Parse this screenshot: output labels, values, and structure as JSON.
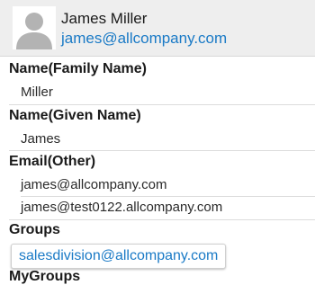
{
  "header": {
    "avatar_icon": "person-silhouette-icon",
    "name": "James Miller",
    "email": "james@allcompany.com"
  },
  "fields": {
    "family_name": {
      "label": "Name(Family Name)",
      "value": "Miller"
    },
    "given_name": {
      "label": "Name(Given Name)",
      "value": "James"
    },
    "email_other": {
      "label": "Email(Other)",
      "values": [
        "james@allcompany.com",
        "james@test0122.allcompany.com"
      ]
    },
    "groups": {
      "label": "Groups",
      "items": [
        "salesdivision@allcompany.com"
      ]
    },
    "my_groups": {
      "label": "MyGroups"
    }
  },
  "colors": {
    "link": "#1a7ac6",
    "header_bg": "#eeeeee",
    "avatar_silhouette": "#b3b3b3"
  }
}
